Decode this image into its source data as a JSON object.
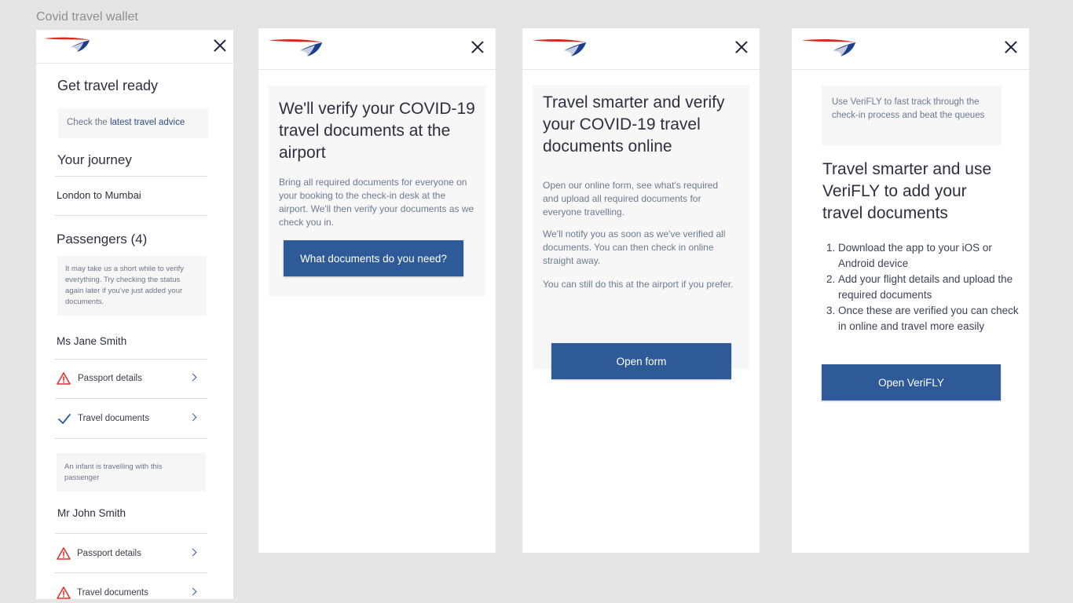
{
  "canvas_title": "Covid travel wallet",
  "colors": {
    "brand_blue": "#2e5a98",
    "warning_red": "#e0312d",
    "check_blue": "#2f5b9b",
    "logo_red": "#d52b1e"
  },
  "icons": {
    "logo": "british-airways-speedmarque",
    "close": "close-icon",
    "warning": "warning-triangle-icon",
    "check": "check-icon",
    "chevron": "chevron-right-icon"
  },
  "screen1": {
    "title": "Get travel ready",
    "advice_prefix": "Check the ",
    "advice_link": "latest travel advice",
    "journey_heading": "Your journey",
    "journey_route": "London to Mumbai",
    "passengers_heading": "Passengers (4)",
    "passengers_note": "It may take us a short while to verify everything. Try checking the status again later if you've just added your documents.",
    "passenger1": {
      "name": "Ms Jane Smith",
      "passport": "Passport details",
      "travel_docs": "Travel documents",
      "infant_note": "An infant is travelling with this passenger"
    },
    "passenger2": {
      "name": "Mr John Smith",
      "passport": "Passport details",
      "travel_docs": "Travel documents"
    }
  },
  "screen2": {
    "headline": "We'll verify your COVID-19 travel documents at the airport",
    "body": "Bring all required documents for everyone on your booking to the check-in desk at the airport. We'll then verify your documents as we check you in.",
    "button": "What documents do you need?"
  },
  "screen3": {
    "headline": "Travel smarter and verify your COVID-19 travel documents online",
    "p1": "Open our online form, see what's required and upload all required documents for everyone travelling.",
    "p2": "We'll notify you as soon as we've verified all documents. You can then check in online straight away.",
    "p3": "You can still do this at the airport if you prefer.",
    "button": "Open form"
  },
  "screen4": {
    "info": "Use VeriFLY to fast track through the check-in process and beat the queues",
    "headline": "Travel smarter and use VeriFLY to add your travel documents",
    "steps": [
      "Download the app to your iOS or Android device",
      "Add your flight details and upload the required documents",
      "Once these are verified you can check in online and travel more easily"
    ],
    "button": "Open VeriFLY"
  }
}
